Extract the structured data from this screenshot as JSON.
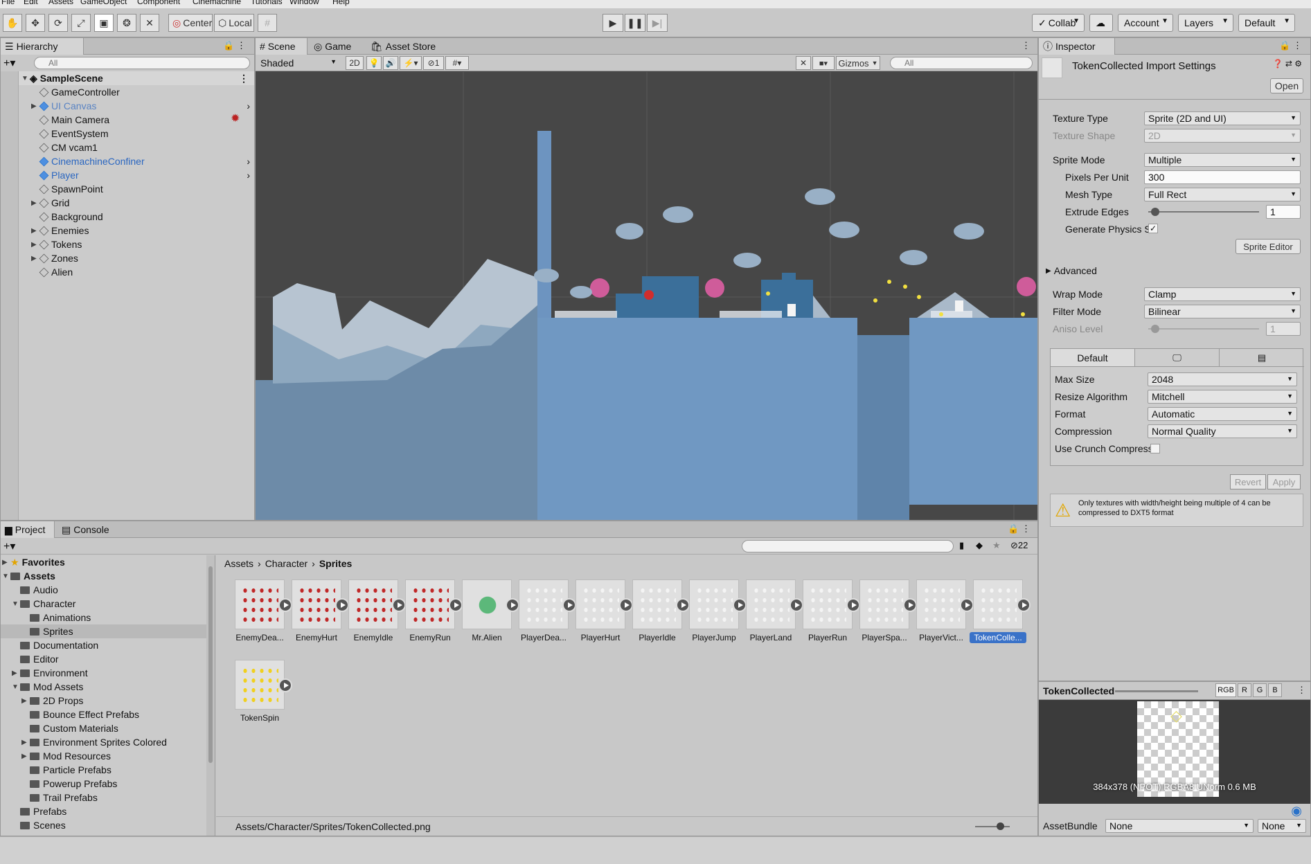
{
  "menu": [
    "File",
    "Edit",
    "Assets",
    "GameObject",
    "Component",
    "Cinemachine",
    "Tutorials",
    "Window",
    "Help"
  ],
  "toolbar": {
    "pivot": "Center",
    "space": "Local",
    "collab": "Collab",
    "account": "Account",
    "layers": "Layers",
    "layout": "Default"
  },
  "hierarchy": {
    "title": "Hierarchy",
    "search_placeholder": "All",
    "scene": "SampleScene",
    "items": [
      {
        "label": "GameController",
        "fold": false,
        "blue": false
      },
      {
        "label": "UI Canvas",
        "fold": true,
        "blue": true,
        "faded": true
      },
      {
        "label": "Main Camera",
        "fold": false,
        "blue": false
      },
      {
        "label": "EventSystem",
        "fold": false,
        "blue": false
      },
      {
        "label": "CM vcam1",
        "fold": false,
        "blue": false
      },
      {
        "label": "CinemachineConfiner",
        "fold": false,
        "blue": true
      },
      {
        "label": "Player",
        "fold": false,
        "blue": true
      },
      {
        "label": "SpawnPoint",
        "fold": false,
        "blue": false
      },
      {
        "label": "Grid",
        "fold": true,
        "blue": false
      },
      {
        "label": "Background",
        "fold": false,
        "blue": false
      },
      {
        "label": "Enemies",
        "fold": true,
        "blue": false
      },
      {
        "label": "Tokens",
        "fold": true,
        "blue": false
      },
      {
        "label": "Zones",
        "fold": true,
        "blue": false
      },
      {
        "label": "Alien",
        "fold": false,
        "blue": false
      }
    ]
  },
  "scene": {
    "tabs": [
      "Scene",
      "Game",
      "Asset Store"
    ],
    "shading": "Shaded",
    "mode2d": "2D",
    "hidden_count": "1",
    "gizmos": "Gizmos",
    "search_placeholder": "All"
  },
  "inspector": {
    "title": "Inspector",
    "asset_title": "TokenCollected Import Settings",
    "open": "Open",
    "texture_type": {
      "label": "Texture Type",
      "value": "Sprite (2D and UI)"
    },
    "texture_shape": {
      "label": "Texture Shape",
      "value": "2D"
    },
    "sprite_mode": {
      "label": "Sprite Mode",
      "value": "Multiple"
    },
    "ppu": {
      "label": "Pixels Per Unit",
      "value": "300"
    },
    "mesh_type": {
      "label": "Mesh Type",
      "value": "Full Rect"
    },
    "extrude": {
      "label": "Extrude Edges",
      "value": "1"
    },
    "gen_physics": {
      "label": "Generate Physics Sl"
    },
    "sprite_editor": "Sprite Editor",
    "advanced": "Advanced",
    "wrap": {
      "label": "Wrap Mode",
      "value": "Clamp"
    },
    "filter": {
      "label": "Filter Mode",
      "value": "Bilinear"
    },
    "aniso": {
      "label": "Aniso Level",
      "value": "1"
    },
    "platform_default": "Default",
    "max_size": {
      "label": "Max Size",
      "value": "2048"
    },
    "resize": {
      "label": "Resize Algorithm",
      "value": "Mitchell"
    },
    "format": {
      "label": "Format",
      "value": "Automatic"
    },
    "compression": {
      "label": "Compression",
      "value": "Normal Quality"
    },
    "crunch": {
      "label": "Use Crunch Compressi"
    },
    "revert": "Revert",
    "apply": "Apply",
    "warning": "Only textures with width/height being multiple of 4 can be compressed to DXT5 format"
  },
  "preview": {
    "title": "TokenCollected",
    "channels": [
      "RGB",
      "R",
      "G",
      "B"
    ],
    "info": "384x378 (NPOT)  RGBA8 UNorm   0.6 MB",
    "assetbundle_label": "AssetBundle",
    "bundle": "None",
    "variant": "None"
  },
  "project": {
    "tabs": [
      "Project",
      "Console"
    ],
    "hidden_count": "22",
    "tree": [
      {
        "label": "Favorites",
        "depth": 0,
        "fold": "closed",
        "bold": true,
        "star": true
      },
      {
        "label": "Assets",
        "depth": 0,
        "fold": "open",
        "bold": true
      },
      {
        "label": "Audio",
        "depth": 1,
        "fold": "none"
      },
      {
        "label": "Character",
        "depth": 1,
        "fold": "open"
      },
      {
        "label": "Animations",
        "depth": 2,
        "fold": "none"
      },
      {
        "label": "Sprites",
        "depth": 2,
        "fold": "none",
        "selected": true
      },
      {
        "label": "Documentation",
        "depth": 1,
        "fold": "none"
      },
      {
        "label": "Editor",
        "depth": 1,
        "fold": "none"
      },
      {
        "label": "Environment",
        "depth": 1,
        "fold": "closed"
      },
      {
        "label": "Mod Assets",
        "depth": 1,
        "fold": "open"
      },
      {
        "label": "2D Props",
        "depth": 2,
        "fold": "closed"
      },
      {
        "label": "Bounce Effect Prefabs",
        "depth": 2,
        "fold": "none"
      },
      {
        "label": "Custom Materials",
        "depth": 2,
        "fold": "none"
      },
      {
        "label": "Environment Sprites Colored",
        "depth": 2,
        "fold": "closed"
      },
      {
        "label": "Mod Resources",
        "depth": 2,
        "fold": "closed"
      },
      {
        "label": "Particle Prefabs",
        "depth": 2,
        "fold": "none"
      },
      {
        "label": "Powerup Prefabs",
        "depth": 2,
        "fold": "none"
      },
      {
        "label": "Trail Prefabs",
        "depth": 2,
        "fold": "none"
      },
      {
        "label": "Prefabs",
        "depth": 1,
        "fold": "none"
      },
      {
        "label": "Scenes",
        "depth": 1,
        "fold": "none"
      }
    ],
    "breadcrumb": [
      "Assets",
      "Character",
      "Sprites"
    ],
    "assets": [
      "EnemyDea...",
      "EnemyHurt",
      "EnemyIdle",
      "EnemyRun",
      "Mr.Alien",
      "PlayerDea...",
      "PlayerHurt",
      "PlayerIdle",
      "PlayerJump",
      "PlayerLand",
      "PlayerRun",
      "PlayerSpa...",
      "PlayerVict...",
      "TokenColle...",
      "TokenSpin"
    ],
    "selected_asset": "TokenColle...",
    "status_path": "Assets/Character/Sprites/TokenCollected.png"
  },
  "colors": {
    "accent": "#3a72c8",
    "scene_bg": "#474747",
    "water": "#6c93b7"
  }
}
